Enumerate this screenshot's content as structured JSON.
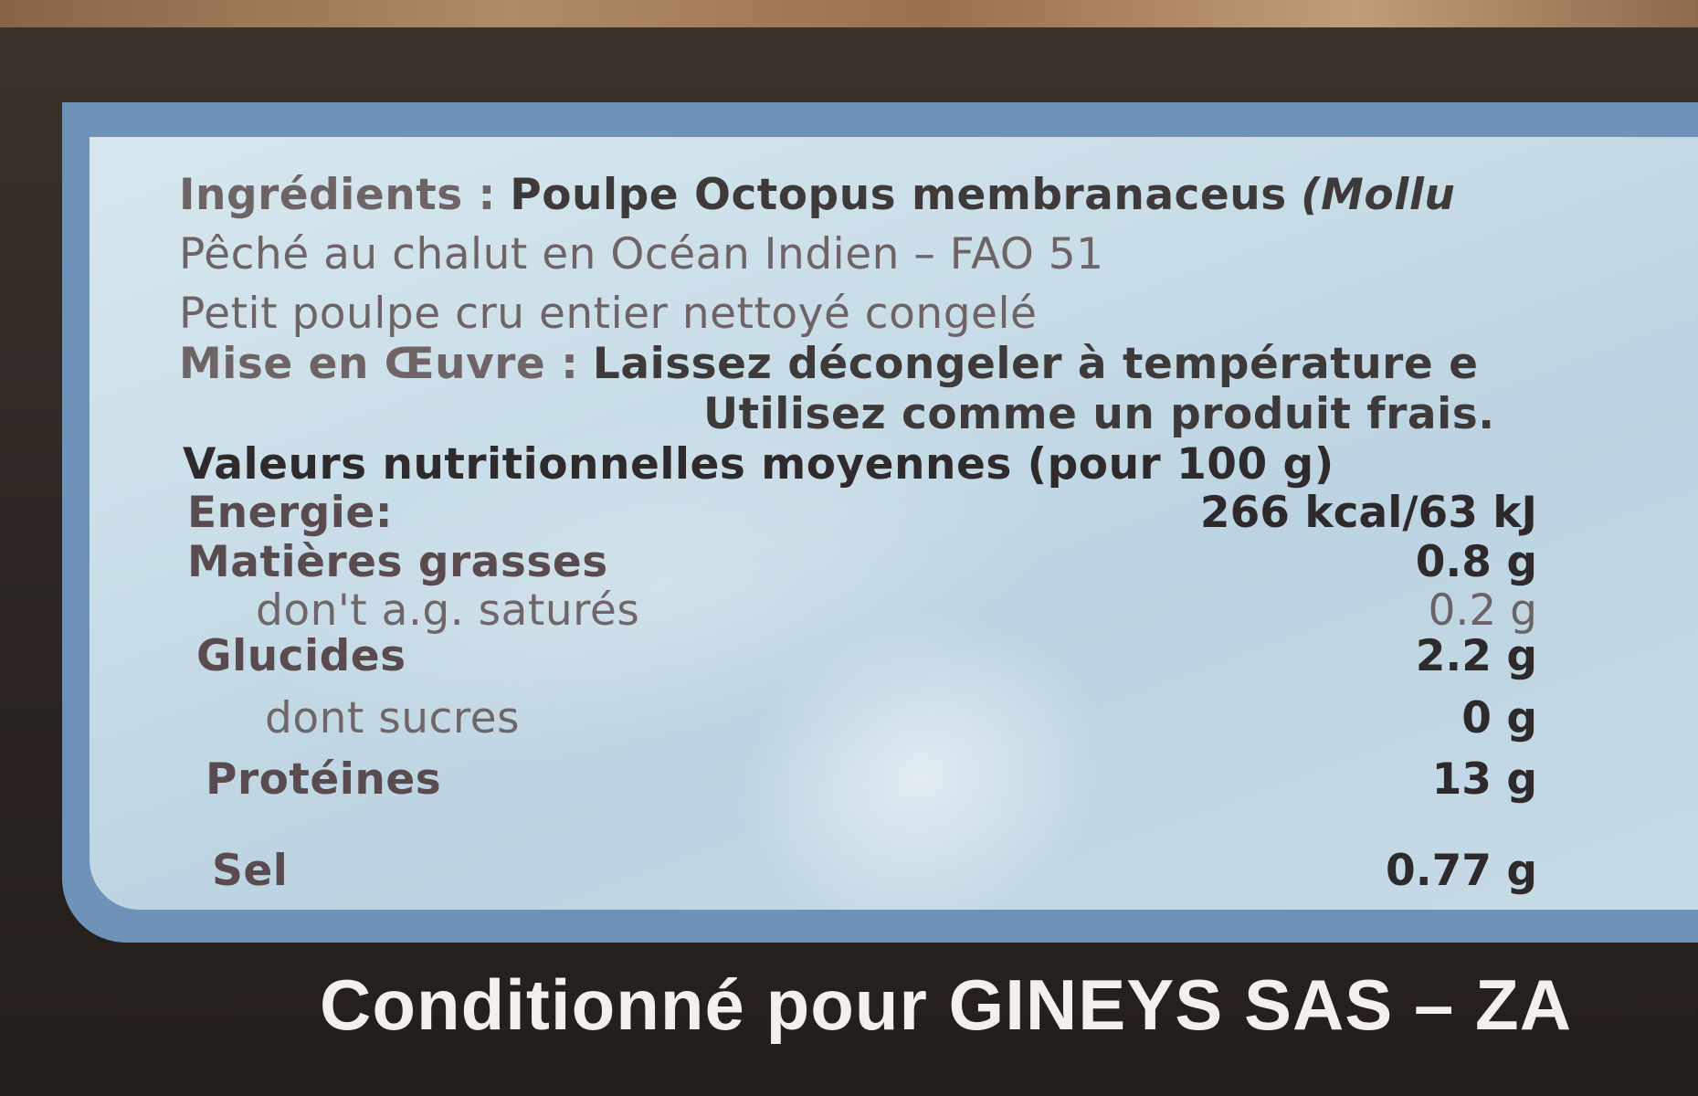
{
  "label": {
    "ingredients": {
      "heading": "Ingrédients :",
      "text": "Poulpe Octopus membranaceus",
      "italic": "(Mollu"
    },
    "line2": "Pêché au chalut en Océan Indien  – FAO 51",
    "line3": "Petit poulpe cru entier nettoyé congelé",
    "preparation": {
      "heading": "Mise en Œuvre :",
      "text": "Laissez décongeler à température e",
      "text2": "Utilisez comme un produit frais."
    },
    "nutrition": {
      "title": "Valeurs nutritionnelles moyennes (pour 100 g)",
      "rows": [
        {
          "label": "Energie:",
          "value": "266 kcal/63 kJ"
        },
        {
          "label": "Matières grasses",
          "value": "0.8 g"
        },
        {
          "label": "don't a.g. saturés",
          "value": "0.2 g"
        },
        {
          "label": "Glucides",
          "value": "2.2 g"
        },
        {
          "label": "dont sucres",
          "value": "0 g"
        },
        {
          "label": "Protéines",
          "value": "13 g"
        },
        {
          "label": "Sel",
          "value": "0.77 g"
        }
      ]
    }
  },
  "footer": "Conditionné pour GINEYS SAS – ZA"
}
